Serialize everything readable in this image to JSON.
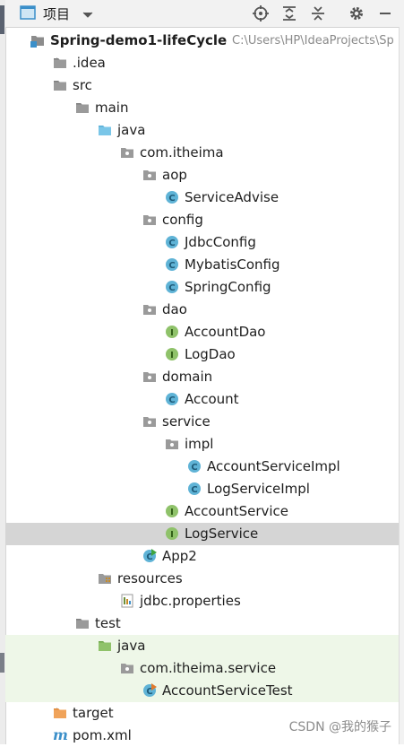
{
  "toolbar": {
    "project_label": "项目"
  },
  "tree": [
    {
      "label": "Spring-demo1-lifeCycle",
      "extra": "C:\\Users\\HP\\IdeaProjects\\Sp",
      "icon": "module-folder-icon",
      "depth": 0,
      "expanded": true,
      "bold": true
    },
    {
      "label": ".idea",
      "icon": "folder-icon",
      "depth": 1,
      "expanded": false
    },
    {
      "label": "src",
      "icon": "folder-icon",
      "depth": 1,
      "expanded": true
    },
    {
      "label": "main",
      "icon": "folder-icon",
      "depth": 2,
      "expanded": true
    },
    {
      "label": "java",
      "icon": "source-root-folder-icon",
      "depth": 3,
      "expanded": true
    },
    {
      "label": "com.itheima",
      "icon": "package-icon",
      "depth": 4,
      "expanded": true
    },
    {
      "label": "aop",
      "icon": "package-icon",
      "depth": 5,
      "expanded": true
    },
    {
      "label": "ServiceAdvise",
      "icon": "class-icon",
      "depth": 6
    },
    {
      "label": "config",
      "icon": "package-icon",
      "depth": 5,
      "expanded": true
    },
    {
      "label": "JdbcConfig",
      "icon": "class-icon",
      "depth": 6
    },
    {
      "label": "MybatisConfig",
      "icon": "class-icon",
      "depth": 6
    },
    {
      "label": "SpringConfig",
      "icon": "class-icon",
      "depth": 6
    },
    {
      "label": "dao",
      "icon": "package-icon",
      "depth": 5,
      "expanded": true
    },
    {
      "label": "AccountDao",
      "icon": "interface-icon",
      "depth": 6
    },
    {
      "label": "LogDao",
      "icon": "interface-icon",
      "depth": 6
    },
    {
      "label": "domain",
      "icon": "package-icon",
      "depth": 5,
      "expanded": true
    },
    {
      "label": "Account",
      "icon": "class-icon",
      "depth": 6
    },
    {
      "label": "service",
      "icon": "package-icon",
      "depth": 5,
      "expanded": true
    },
    {
      "label": "impl",
      "icon": "package-icon",
      "depth": 6,
      "expanded": true
    },
    {
      "label": "AccountServiceImpl",
      "icon": "class-icon",
      "depth": 7
    },
    {
      "label": "LogServiceImpl",
      "icon": "class-icon",
      "depth": 7
    },
    {
      "label": "AccountService",
      "icon": "interface-icon",
      "depth": 6
    },
    {
      "label": "LogService",
      "icon": "interface-icon",
      "depth": 6,
      "selected": true
    },
    {
      "label": "App2",
      "icon": "runnable-class-icon",
      "depth": 5
    },
    {
      "label": "resources",
      "icon": "resources-folder-icon",
      "depth": 3,
      "expanded": true
    },
    {
      "label": "jdbc.properties",
      "icon": "properties-file-icon",
      "depth": 4
    },
    {
      "label": "test",
      "icon": "folder-icon",
      "depth": 2,
      "expanded": true
    },
    {
      "label": "java",
      "icon": "test-root-folder-icon",
      "depth": 3,
      "expanded": true,
      "test": true
    },
    {
      "label": "com.itheima.service",
      "icon": "package-icon",
      "depth": 4,
      "expanded": true,
      "test": true
    },
    {
      "label": "AccountServiceTest",
      "icon": "test-class-icon",
      "depth": 5,
      "test": true
    },
    {
      "label": "target",
      "icon": "excluded-folder-icon",
      "depth": 1,
      "expanded": false
    },
    {
      "label": "pom.xml",
      "icon": "maven-icon",
      "depth": 1
    }
  ],
  "watermark": "CSDN @我的猴子",
  "colors": {
    "selection": "#d5d5d5",
    "test_row": "#eef7e8",
    "class_icon": "#5fb3d6",
    "interface_icon": "#8fc26a",
    "folder": "#8c8c8c",
    "excluded_folder": "#f0a35a"
  }
}
